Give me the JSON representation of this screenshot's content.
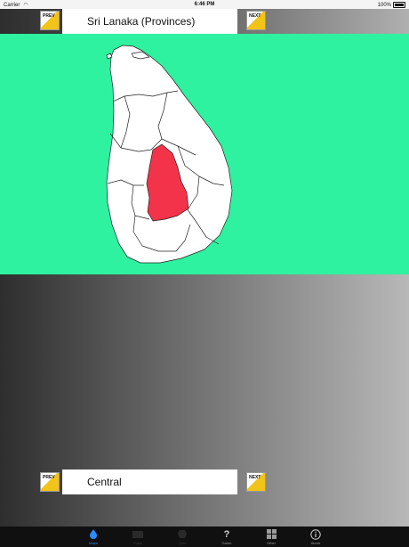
{
  "status_bar": {
    "carrier": "Carrier",
    "time": "6:46 PM",
    "battery": "100%"
  },
  "header": {
    "prev_label": "PREV",
    "next_label": "NEXT",
    "title": "Sri Lanaka (Provinces)"
  },
  "footer": {
    "prev_label": "PREV",
    "next_label": "NEXT",
    "selected_region": "Central"
  },
  "colors": {
    "map_background": "#2ef2a0",
    "province_fill": "#ffffff",
    "selected_fill": "#f2334a",
    "nav_accent": "#f2c318",
    "tab_active": "#2b8cff"
  },
  "tabs": [
    {
      "label": "Maps",
      "icon": "map-pin-icon",
      "state": "active"
    },
    {
      "label": "Flags",
      "icon": "flag-icon",
      "state": "disabled"
    },
    {
      "label": "Quiz",
      "icon": "quiz-icon",
      "state": "disabled"
    },
    {
      "label": "Game",
      "icon": "question-icon",
      "state": "normal"
    },
    {
      "label": "Other",
      "icon": "grid-icon",
      "state": "normal"
    },
    {
      "label": "About",
      "icon": "info-icon",
      "state": "normal"
    }
  ]
}
